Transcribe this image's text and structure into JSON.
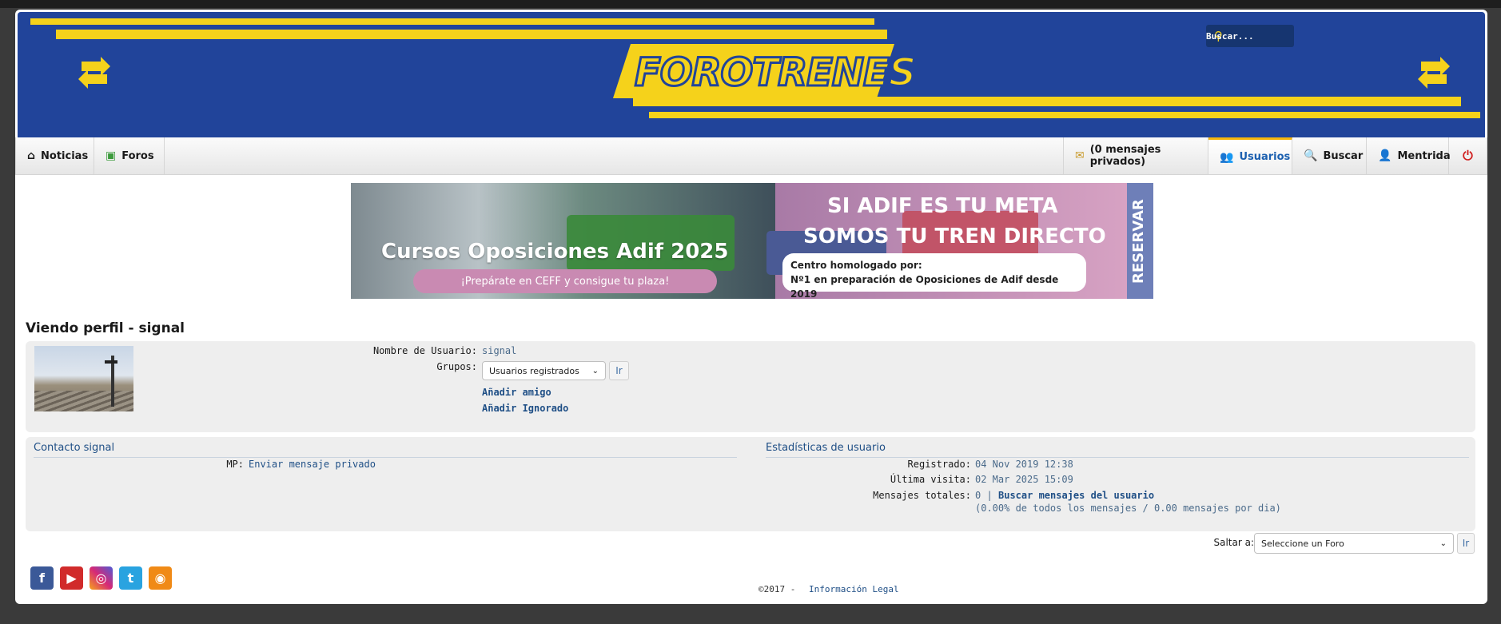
{
  "header": {
    "logo_text": "FOROTRENES",
    "search_placeholder": "Buscar..."
  },
  "nav": {
    "left": [
      {
        "label": "Noticias",
        "icon": "home-icon"
      },
      {
        "label": "Foros",
        "icon": "chat-icon"
      }
    ],
    "right": [
      {
        "label": "(0 mensajes privados)",
        "icon": "envelope-icon"
      },
      {
        "label": "Usuarios",
        "icon": "users-icon",
        "active": true
      },
      {
        "label": "Buscar",
        "icon": "magnifier-icon"
      },
      {
        "label": "Mentrida",
        "icon": "user-icon"
      },
      {
        "label": "",
        "icon": "power-icon"
      }
    ]
  },
  "banner": {
    "left_title": "Cursos Oposiciones Adif 2025",
    "left_pill": "¡Prepárate en CEFF y consigue tu plaza!",
    "right_line1": "SI ADIF ES TU META",
    "right_line2": "SOMOS TU TREN DIRECTO",
    "right_box1": "Centro homologado por:",
    "right_box2": "Nº1 en preparación de Oposiciones de Adif desde 2019",
    "side": "RESERVAR"
  },
  "profile": {
    "title": "Viendo perfil - signal",
    "username_label": "Nombre de Usuario:",
    "username_value": "signal",
    "groups_label": "Grupos:",
    "groups_selected": "Usuarios registrados",
    "go_button": "Ir",
    "add_friend": "Añadir amigo",
    "add_ignored": "Añadir Ignorado"
  },
  "contact": {
    "heading": "Contacto signal",
    "pm_label": "MP:",
    "pm_link": "Enviar mensaje privado"
  },
  "stats": {
    "heading": "Estadísticas de usuario",
    "registered_label": "Registrado:",
    "registered_value": "04 Nov 2019 12:38",
    "last_visit_label": "Última visita:",
    "last_visit_value": "02 Mar 2025 15:09",
    "total_label": "Mensajes totales:",
    "total_value": "0 |",
    "search_link": "Buscar mensajes del usuario",
    "total_detail": "(0.00% de todos los mensajes / 0.00 mensajes por dia)"
  },
  "jump": {
    "label": "Saltar a:",
    "selected": "Seleccione un Foro",
    "button": "Ir"
  },
  "footer": {
    "copyright": "©2017 -",
    "legal_link": "Información Legal",
    "social": [
      "facebook-icon",
      "youtube-icon",
      "instagram-icon",
      "twitter-icon",
      "rss-icon"
    ]
  },
  "colors": {
    "brand_blue": "#21449a",
    "brand_yellow": "#f5d21b",
    "link": "#1f4f86",
    "active_nav": "#1c60b0"
  }
}
